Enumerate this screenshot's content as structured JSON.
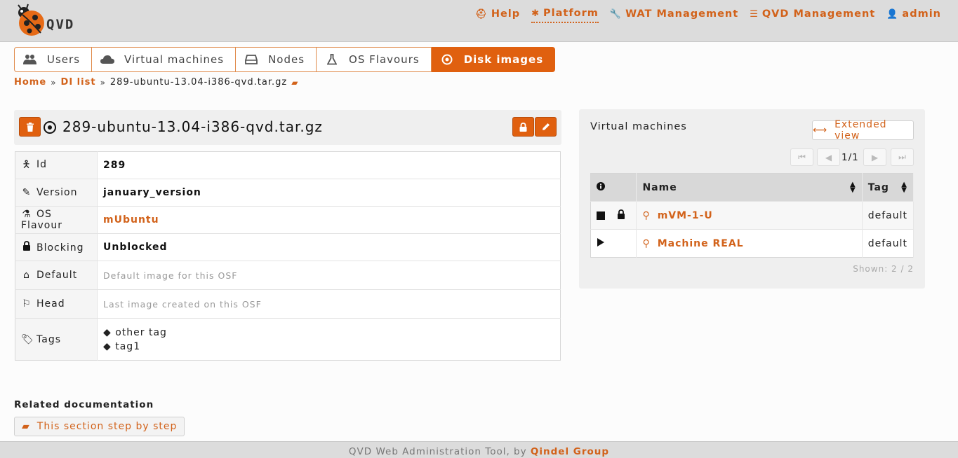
{
  "app": {
    "logo_text": "QVD"
  },
  "topmenu": [
    {
      "label": "Help",
      "icon": "lifebuoy-icon"
    },
    {
      "label": "Platform",
      "icon": "bug-icon"
    },
    {
      "label": "WAT Management",
      "icon": "wrench-icon"
    },
    {
      "label": "QVD Management",
      "icon": "sliders-icon"
    },
    {
      "label": "admin",
      "icon": "user-icon"
    }
  ],
  "tabs": [
    {
      "label": "Users"
    },
    {
      "label": "Virtual machines"
    },
    {
      "label": "Nodes"
    },
    {
      "label": "OS Flavours"
    },
    {
      "label": "Disk images"
    }
  ],
  "breadcrumb": {
    "home": "Home",
    "list": "DI list",
    "current": "289-ubuntu-13.04-i386-qvd.tar.gz"
  },
  "detail": {
    "title": "289-ubuntu-13.04-i386-qvd.tar.gz",
    "rows": {
      "id": {
        "label": "Id",
        "value": "289"
      },
      "version": {
        "label": "Version",
        "value": "january_version"
      },
      "osf": {
        "label": "OS Flavour",
        "value": "mUbuntu"
      },
      "blocking": {
        "label": "Blocking",
        "value": "Unblocked"
      },
      "default": {
        "label": "Default",
        "value": "Default image for this OSF"
      },
      "head": {
        "label": "Head",
        "value": "Last image created on this OSF"
      },
      "tags": {
        "label": "Tags",
        "values": [
          "other tag",
          "tag1"
        ]
      }
    }
  },
  "related": {
    "title": "Related documentation",
    "button": "This section step by step"
  },
  "vm_panel": {
    "title": "Virtual machines",
    "extended_view": "Extended view",
    "page_text": "1/1",
    "columns": {
      "name": "Name",
      "tag": "Tag"
    },
    "rows": [
      {
        "name": "mVM-1-U",
        "tag": "default"
      },
      {
        "name": "Machine REAL",
        "tag": "default"
      }
    ],
    "shown": "Shown: 2 / 2"
  },
  "footer": {
    "text": "QVD Web Administration Tool, by ",
    "link": "Qindel Group"
  },
  "colors": {
    "accent": "#e0600f",
    "link": "#d2621a"
  }
}
